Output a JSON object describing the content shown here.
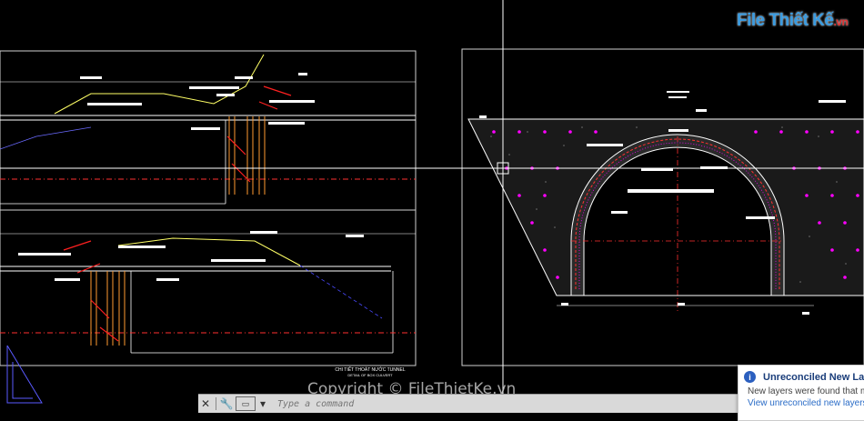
{
  "branding": {
    "logo_text": "File Thiết Kế",
    "logo_suffix": ".vn",
    "copyright": "Copyright © FileThietKe.vn"
  },
  "drawing": {
    "section_caption_1": "CHI TIẾT THOÁT NƯỚC TUNNEL",
    "section_caption_2": "DETAIL OF BOX CULVERT"
  },
  "command_line": {
    "placeholder": "Type a command",
    "close_icon": "close-icon",
    "settings_icon": "wrench-icon"
  },
  "notification": {
    "title": "Unreconciled New Layers",
    "body": "New layers were found that ma",
    "link": "View unreconciled new layers in"
  },
  "colors": {
    "background": "#000000",
    "crosshair": "#ffffff",
    "magenta": "#ff00ff",
    "red": "#ff3030",
    "yellow": "#ffff66"
  }
}
